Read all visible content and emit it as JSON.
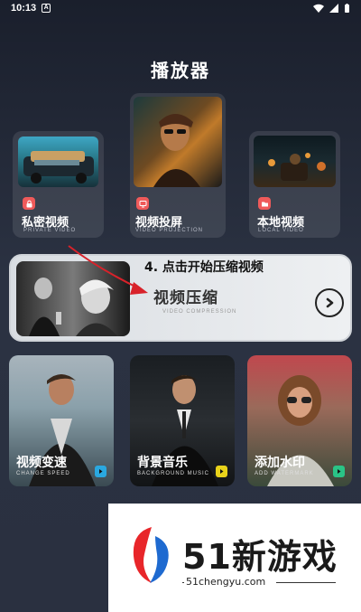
{
  "status_bar": {
    "time": "10:13",
    "badge": "A"
  },
  "page": {
    "title": "播放器"
  },
  "top_features": [
    {
      "label": "私密视频",
      "sub": "PRIVATE VIDEO",
      "icon": "lock-icon"
    },
    {
      "label": "视频投屏",
      "sub": "VIDEO PROJECTION",
      "icon": "cast-icon"
    },
    {
      "label": "本地视频",
      "sub": "LOCAL VIDEO",
      "icon": "folder-icon"
    }
  ],
  "compress": {
    "title": "视频压缩",
    "sub": "VIDEO COMPRESSION",
    "annotation": "4. 点击开始压缩视频"
  },
  "bottom_features": [
    {
      "label": "视频变速",
      "sub": "CHANGE SPEED",
      "accent": "#2aa8e0"
    },
    {
      "label": "背景音乐",
      "sub": "BACKGROUND MUSIC",
      "accent": "#e8d21a"
    },
    {
      "label": "添加水印",
      "sub": "ADD WATERMARK",
      "accent": "#2ac486"
    }
  ],
  "watermark": {
    "brand": "51新游戏",
    "url": "51chengyu.com"
  },
  "colors": {
    "feature_icon": "#ef5a5a",
    "annotation_arrow": "#d8222a"
  }
}
